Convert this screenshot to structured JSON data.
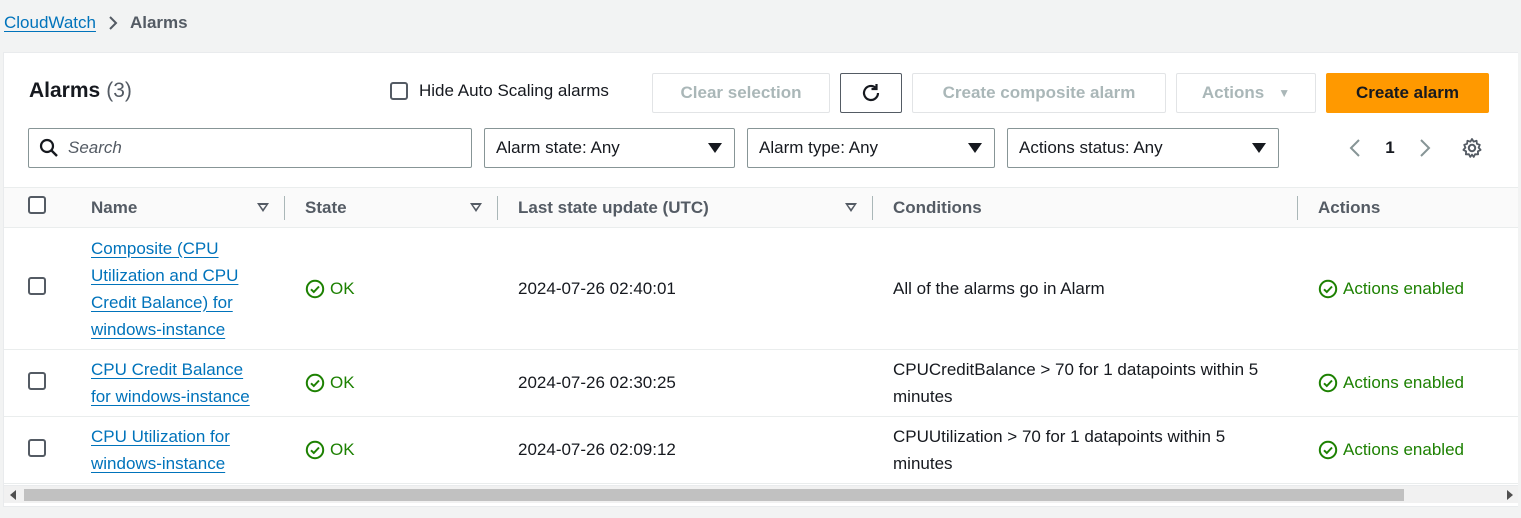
{
  "breadcrumb": {
    "root": "CloudWatch",
    "current": "Alarms"
  },
  "header": {
    "title": "Alarms",
    "count": "(3)"
  },
  "toolbar": {
    "hide_autoscaling_label": "Hide Auto Scaling alarms",
    "clear_selection": "Clear selection",
    "create_composite": "Create composite alarm",
    "actions": "Actions",
    "create_alarm": "Create alarm"
  },
  "filters": {
    "search_placeholder": "Search",
    "alarm_state": "Alarm state: Any",
    "alarm_type": "Alarm type: Any",
    "actions_status": "Actions status: Any"
  },
  "pagination": {
    "page": "1"
  },
  "table": {
    "columns": [
      "Name",
      "State",
      "Last state update (UTC)",
      "Conditions",
      "Actions"
    ],
    "rows": [
      {
        "name_lines": [
          "Composite (CPU",
          "Utilization and CPU",
          "Credit Balance) for",
          "windows-instance"
        ],
        "state": "OK",
        "last_update": "2024-07-26 02:40:01",
        "condition_lines": [
          "All of the alarms go in Alarm"
        ],
        "actions": "Actions enabled"
      },
      {
        "name_lines": [
          "CPU Credit Balance",
          "for windows-instance"
        ],
        "state": "OK",
        "last_update": "2024-07-26 02:30:25",
        "condition_lines": [
          "CPUCreditBalance > 70 for 1 datapoints within 5",
          "minutes"
        ],
        "actions": "Actions enabled"
      },
      {
        "name_lines": [
          "CPU Utilization for",
          "windows-instance"
        ],
        "state": "OK",
        "last_update": "2024-07-26 02:09:12",
        "condition_lines": [
          "CPUUtilization > 70 for 1 datapoints within 5",
          "minutes"
        ],
        "actions": "Actions enabled"
      }
    ]
  },
  "colors": {
    "link": "#0073bb",
    "ok": "#1d8102",
    "primary": "#ff9900"
  }
}
